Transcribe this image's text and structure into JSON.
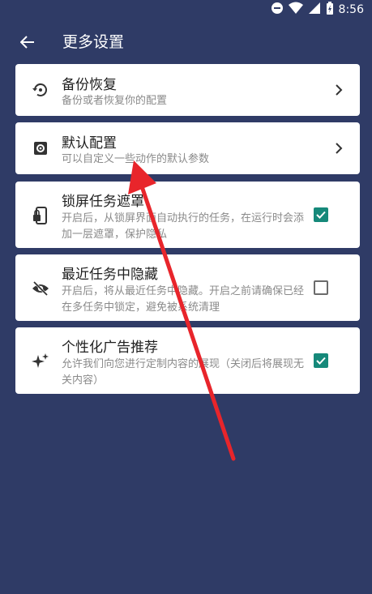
{
  "status_bar": {
    "time": "8:56"
  },
  "app_bar": {
    "title": "更多设置"
  },
  "colors": {
    "background": "#2f3b66",
    "accent": "#16897a",
    "arrow": "#e8252b"
  },
  "settings": [
    {
      "title": "备份恢复",
      "description": "备份或者恢复你的配置",
      "icon": "restore-icon",
      "control": "chevron"
    },
    {
      "title": "默认配置",
      "description": "可以自定义一些动作的默认参数",
      "icon": "gear-icon",
      "control": "chevron"
    },
    {
      "title": "锁屏任务遮罩",
      "description": "开启后，从锁屏界面自动执行的任务，在运行时会添加一层遮罩，保护隐私",
      "icon": "phone-lock-icon",
      "control": "checkbox",
      "checked": true
    },
    {
      "title": "最近任务中隐藏",
      "description": "开启后，将从最近任务中隐藏。开启之前请确保已经在多任务中锁定，避免被系统清理",
      "icon": "eye-off-icon",
      "control": "checkbox",
      "checked": false
    },
    {
      "title": "个性化广告推荐",
      "description": "允许我们向您进行定制内容的展现（关闭后将展现无关内容）",
      "icon": "sparkle-icon",
      "control": "checkbox",
      "checked": true
    }
  ]
}
